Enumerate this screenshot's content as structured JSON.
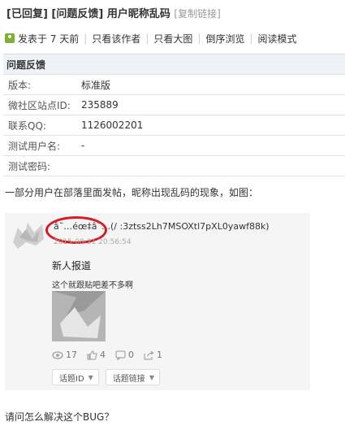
{
  "title": {
    "status_tag": "[已回复]",
    "type_tag": "[问题反馈]",
    "text": "用户昵称乱码",
    "copy_link": "[复制链接]"
  },
  "toolbar": {
    "posted": "发表于 7 天前",
    "only_author": "只看该作者",
    "big_image": "只看大图",
    "reverse": "倒序浏览",
    "read_mode": "阅读模式"
  },
  "feedback": {
    "heading": "问题反馈",
    "rows": [
      {
        "label": "版本:",
        "value": "标准版"
      },
      {
        "label": "微社区站点ID:",
        "value": "235889"
      },
      {
        "label": "联系QQ:",
        "value": "1126002201"
      },
      {
        "label": "测试用户名:",
        "value": "-"
      },
      {
        "label": "测试密码:",
        "value": ""
      }
    ]
  },
  "description": "一部分用户在部落里面发帖，昵称出现乱码的现象，如图：",
  "screenshot": {
    "nickname": "â˜…éœ‡â˜…(/ :3ztss2Lh7MSOXtl7pXL0yawf88k)",
    "time": "2015-08-21 20:56:54",
    "post_title": "新人报道",
    "post_body": "这个就跟贴吧差不多啊",
    "stats": {
      "views": "17",
      "likes": "4",
      "comments": "0",
      "shares": "1"
    },
    "tags": [
      "话题ID",
      "话题链接"
    ]
  },
  "question": "请问怎么解决这个BUG？",
  "colors": {
    "header_bg": "#eef1f5",
    "highlight_ring": "#d8191f",
    "user_icon": "#7ab233"
  }
}
